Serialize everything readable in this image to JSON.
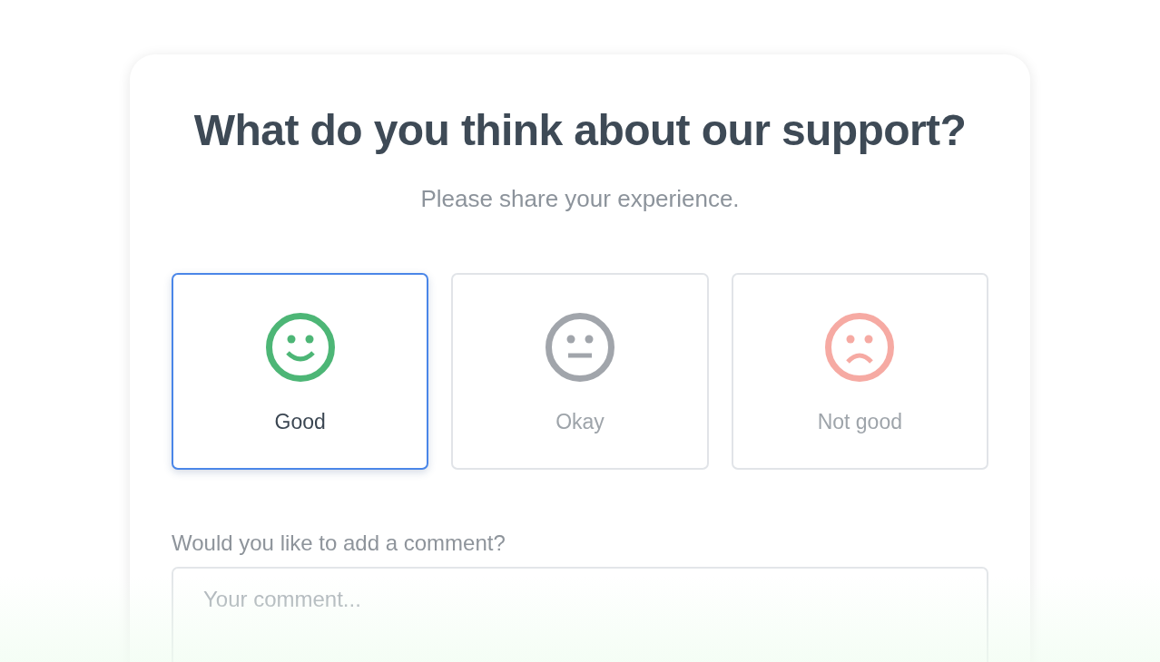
{
  "card": {
    "title": "What do you think about our support?",
    "subtitle": "Please share your experience.",
    "options": [
      {
        "kind": "happy",
        "label": "Good",
        "selected": true,
        "color": "#4db676"
      },
      {
        "kind": "neutral",
        "label": "Okay",
        "selected": false,
        "color": "#a1a5ab"
      },
      {
        "kind": "sad",
        "label": "Not good",
        "selected": false,
        "color": "#f6aaa3"
      }
    ],
    "comment": {
      "label": "Would you like to add a comment?",
      "placeholder": "Your comment..."
    }
  }
}
